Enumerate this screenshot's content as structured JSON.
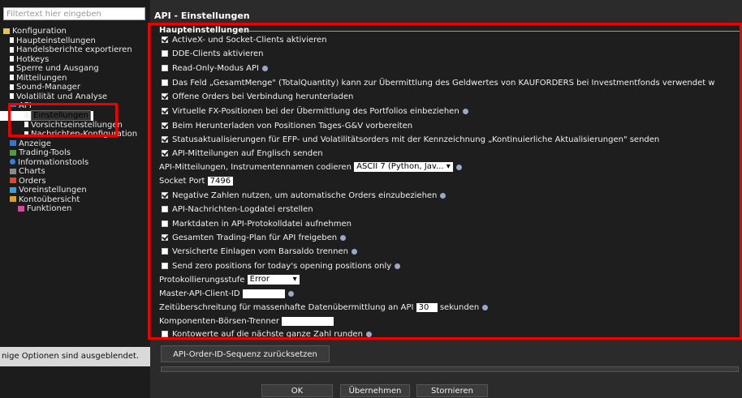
{
  "sidebar": {
    "filter_placeholder": "Filtertext hier eingeben",
    "tree": [
      {
        "label": "Konfiguration",
        "icon": "folder-icon"
      },
      {
        "label": "Haupteinstellungen",
        "icon": "page-icon"
      },
      {
        "label": "Handelsberichte exportieren",
        "icon": "page-icon"
      },
      {
        "label": "Hotkeys",
        "icon": "page-icon"
      },
      {
        "label": "Sperre und Ausgang",
        "icon": "page-icon"
      },
      {
        "label": "Mitteilungen",
        "icon": "page-icon"
      },
      {
        "label": "Sound-Manager",
        "icon": "page-icon"
      },
      {
        "label": "Volatilität und Analyse",
        "icon": "page-icon"
      },
      {
        "label": "API",
        "icon": "api-icon"
      },
      {
        "label": "Einstellungen",
        "icon": "page-icon"
      },
      {
        "label": "Vorsichtseinstellungen",
        "icon": "page-icon"
      },
      {
        "label": "Nachrichten-Konfiguration",
        "icon": "page-icon"
      },
      {
        "label": "Anzeige",
        "icon": "display-icon"
      },
      {
        "label": "Trading-Tools",
        "icon": "trading-tools-icon"
      },
      {
        "label": "Informationstools",
        "icon": "info-icon"
      },
      {
        "label": "Charts",
        "icon": "chart-icon"
      },
      {
        "label": "Orders",
        "icon": "orders-icon"
      },
      {
        "label": "Voreinstellungen",
        "icon": "presets-icon"
      },
      {
        "label": "Kontoübersicht",
        "icon": "account-icon"
      },
      {
        "label": "Funktionen",
        "icon": "functions-icon"
      }
    ],
    "hidden_options_text": "nige Optionen sind ausgeblendet."
  },
  "main": {
    "title": "API - Einstellungen",
    "section_title": "Haupteinstellungen",
    "rows": [
      {
        "type": "checkbox",
        "checked": true,
        "label": "ActiveX- und Socket-Clients aktivieren",
        "help": false
      },
      {
        "type": "checkbox",
        "checked": false,
        "label": "DDE-Clients aktivieren",
        "help": false
      },
      {
        "type": "checkbox",
        "checked": false,
        "label": "Read-Only-Modus API",
        "help": true
      },
      {
        "type": "checkbox",
        "checked": false,
        "label": "Das Feld „GesamtMenge\" (TotalQuantity) kann zur Übermittlung des Geldwertes von KAUFORDERS bei Investmentfonds verwendet w",
        "help": false
      },
      {
        "type": "checkbox",
        "checked": true,
        "label": "Offene Orders bei Verbindung herunterladen",
        "help": false
      },
      {
        "type": "checkbox",
        "checked": true,
        "label": "Virtuelle FX-Positionen bei der Übermittlung des Portfolios einbeziehen",
        "help": true
      },
      {
        "type": "checkbox",
        "checked": true,
        "label": "Beim Herunterladen von Positionen Tages-G&V vorbereiten",
        "help": false
      },
      {
        "type": "checkbox",
        "checked": true,
        "label": "Statusaktualisierungen für EFP- und Volatilitätsorders mit der Kennzeichnung „Kontinuierliche Aktualisierungen\" senden",
        "help": false
      },
      {
        "type": "checkbox",
        "checked": true,
        "label": "API-Mitteilungen auf Englisch senden",
        "help": false
      },
      {
        "type": "select",
        "label": "API-Mitteilungen, Instrumentennamen codieren",
        "value": "ASCII 7 (Python, Jav...",
        "help": true
      },
      {
        "type": "input",
        "label": "Socket Port",
        "value": "7496",
        "help": false
      },
      {
        "type": "checkbox",
        "checked": true,
        "label": "Negative Zahlen nutzen, um automatische Orders einzubeziehen",
        "help": true
      },
      {
        "type": "checkbox",
        "checked": false,
        "label": "API-Nachrichten-Logdatei erstellen",
        "help": false
      },
      {
        "type": "checkbox",
        "checked": false,
        "label": "Marktdaten in API-Protokolldatei aufnehmen",
        "help": false
      },
      {
        "type": "checkbox",
        "checked": true,
        "label": "Gesamten Trading-Plan für API freigeben",
        "help": true
      },
      {
        "type": "checkbox",
        "checked": false,
        "label": "Versicherte Einlagen vom Barsaldo trennen",
        "help": true
      },
      {
        "type": "checkbox",
        "checked": false,
        "label": "Send zero positions for today's opening positions only",
        "help": true
      },
      {
        "type": "select",
        "label": "Protokollierungsstufe",
        "value": "Error",
        "help": false
      },
      {
        "type": "input",
        "label": "Master-API-Client-ID",
        "value": "",
        "help": true
      },
      {
        "type": "input_suffix",
        "label": "Zeitüberschreitung für massenhafte Datenübermittlung an API",
        "value": "30",
        "suffix": "sekunden",
        "help": true
      },
      {
        "type": "input",
        "label": "Komponenten-Börsen-Trenner",
        "value": "",
        "help": false
      },
      {
        "type": "checkbox",
        "checked": false,
        "label": "Kontowerte auf die nächste ganze Zahl runden",
        "help": true
      }
    ],
    "reset_button": "API-Order-ID-Sequenz zurücksetzen"
  },
  "footer": {
    "ok": "OK",
    "apply": "Übernehmen",
    "cancel": "Stornieren"
  },
  "colors": {
    "highlight": "#e00000",
    "panel": "#1e1e1e",
    "background": "#2b2b2b"
  }
}
